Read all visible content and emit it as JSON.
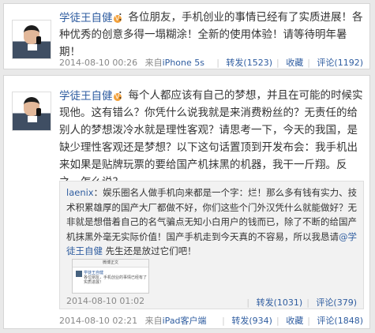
{
  "posts": [
    {
      "author": "学徒王自健",
      "verified_badge": "V",
      "text": "：各位朋友，手机创业的事情已经有了实质进展！各种优秀的创意多得一塌糊涂！全新的使用体验！请等待明年暑期！",
      "time": "2014-08-10 00:26",
      "source_prefix": "来自",
      "source": "iPhone 5s",
      "actions": {
        "like": "",
        "repost": "转发(1523)",
        "favorite": "收藏",
        "comment": "评论(1192)"
      }
    },
    {
      "author": "学徒王自健",
      "verified_badge": "V",
      "text": "：每个人都应该有自己的梦想，并且在可能的时候实现他。这有错么？你凭什么说我就是来消费粉丝的？无责任的给别人的梦想泼冷水就是理性客观？请思考一下，今天的我国，是缺少理性客观还是梦想？以下这句话置顶到开发布会：我手机出来如果是贴牌玩票的要给国产机抹黑的机器，我干一斤翔。反之，怎么说？",
      "time": "2014-08-10 02:21",
      "source_prefix": "来自",
      "source": "iPad客户端",
      "actions": {
        "like": "",
        "repost": "转发(934)",
        "favorite": "收藏",
        "comment": "评论(1848)"
      },
      "quote": {
        "user": "laenix",
        "text": "：娱乐圈名人做手机向来都是一个字：烂！那么多有钱有实力、技术积累雄厚的国产大厂都做不好，你们这些个门外汉凭什么就能做好？无非就是想借着自己的名气骗点无知小白用户的钱而已，除了不断的给国产机抹黑外毫无实际价值！国产手机走到今天真的不容易，所以我恳请",
        "mention": "@学徒王自健",
        "text_tail": " 先生还是放过它们吧！",
        "thumb": {
          "bar": "微博正文",
          "name": "学徒王自健",
          "line": "各位朋友，手机创业的事情已经有了实质进展！"
        },
        "time": "2014-08-10 01:02",
        "actions": {
          "like": "",
          "repost": "转发(1031)",
          "comment": "评论(379)"
        }
      }
    }
  ]
}
